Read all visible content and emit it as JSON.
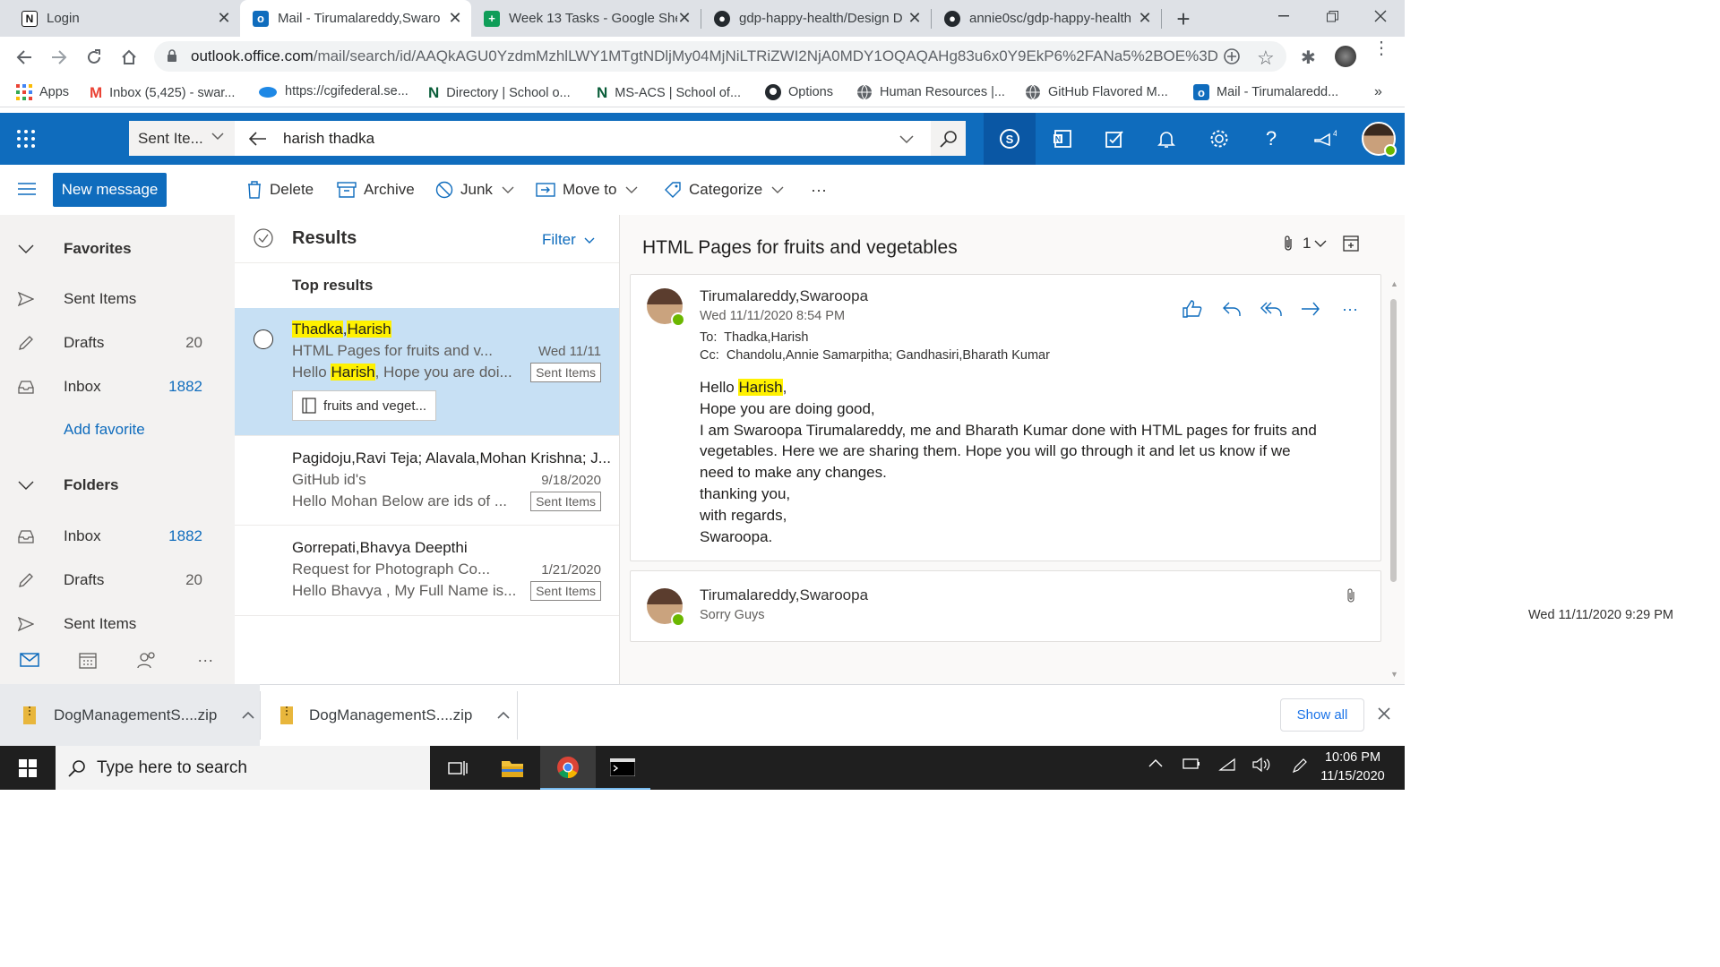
{
  "browser": {
    "tabs": [
      {
        "title": "Login",
        "icon": "notion-icon",
        "active": false
      },
      {
        "title": "Mail - Tirumalareddy,Swaro",
        "icon": "outlook-icon",
        "active": true
      },
      {
        "title": "Week 13 Tasks - Google She",
        "icon": "sheets-icon",
        "active": false
      },
      {
        "title": "gdp-happy-health/Design D",
        "icon": "github-icon",
        "active": false
      },
      {
        "title": "annie0sc/gdp-happy-health",
        "icon": "github-icon",
        "active": false
      }
    ],
    "url_host": "outlook.office.com",
    "url_path": "/mail/search/id/AAQkAGU0YzdmMzhlLWY1MTgtNDljMy04MjNiLTRiZWI2NjA0MDY1OQAQAHg83u6x0Y9EkP6%2FANa5%2BOE%3D",
    "bookmarks": [
      {
        "label": "Apps",
        "icon": "apps-grid-icon"
      },
      {
        "label": "Inbox (5,425) - swar...",
        "icon": "gmail-icon"
      },
      {
        "label": "https://cgifederal.se...",
        "icon": "cloud-icon"
      },
      {
        "label": "Directory | School o...",
        "icon": "notion-icon"
      },
      {
        "label": "MS-ACS | School of...",
        "icon": "notion-icon"
      },
      {
        "label": "Options",
        "icon": "github-icon"
      },
      {
        "label": "Human Resources |...",
        "icon": "globe-icon"
      },
      {
        "label": "GitHub Flavored M...",
        "icon": "globe-icon"
      },
      {
        "label": "Mail - Tirumalaredd...",
        "icon": "outlook-icon"
      }
    ]
  },
  "owa": {
    "scope": "Sent Ite...",
    "search_query": "harish thadka",
    "toolbar": {
      "new_message": "New message",
      "delete": "Delete",
      "archive": "Archive",
      "junk": "Junk",
      "move_to": "Move to",
      "categorize": "Categorize",
      "more": "···"
    },
    "nav": {
      "favorites_label": "Favorites",
      "favorites": [
        {
          "label": "Sent Items",
          "count": "",
          "icon": "send-icon"
        },
        {
          "label": "Drafts",
          "count": "20",
          "icon": "pencil-icon"
        },
        {
          "label": "Inbox",
          "count": "1882",
          "icon": "inbox-icon"
        }
      ],
      "add_favorite": "Add favorite",
      "folders_label": "Folders",
      "folders": [
        {
          "label": "Inbox",
          "count": "1882",
          "icon": "inbox-icon"
        },
        {
          "label": "Drafts",
          "count": "20",
          "icon": "pencil-icon"
        },
        {
          "label": "Sent Items",
          "count": "",
          "icon": "send-icon"
        }
      ]
    },
    "list": {
      "title": "Results",
      "filter": "Filter",
      "section": "Top results",
      "items": [
        {
          "from_a": "Thadka",
          "from_sep": ",",
          "from_b": "Harish",
          "subject": "HTML Pages for fruits and v...",
          "date": "Wed 11/11",
          "preview_a": "Hello ",
          "preview_hl": "Harish",
          "preview_b": ", Hope you are doi...",
          "tag": "Sent Items",
          "attachment": "fruits and veget..."
        },
        {
          "from": "Pagidoju,Ravi Teja; Alavala,Mohan Krishna; J...",
          "subject": "GitHub id's",
          "date": "9/18/2020",
          "preview": "Hello Mohan Below are ids of ...",
          "tag": "Sent Items"
        },
        {
          "from": "Gorrepati,Bhavya Deepthi",
          "subject": "Request for Photograph Co...",
          "date": "1/21/2020",
          "preview": "Hello Bhavya , My Full Name is...",
          "tag": "Sent Items"
        }
      ]
    },
    "reading": {
      "subject": "HTML Pages for fruits and vegetables",
      "attach_count": "1",
      "message1": {
        "sender": "Tirumalareddy,Swaroopa",
        "datetime": "Wed 11/11/2020 8:54 PM",
        "to_label": "To:",
        "to": "Thadka,Harish",
        "cc_label": "Cc:",
        "cc": "Chandolu,Annie Samarpitha; Gandhasiri,Bharath Kumar",
        "greeting_a": "Hello ",
        "greeting_hl": "Harish",
        "greeting_b": ",",
        "lines": [
          "Hope you are doing good,",
          "I am Swaroopa Tirumalareddy, me and Bharath Kumar done with HTML pages for fruits and",
          "vegetables. Here we are sharing them. Hope you will go through it and let us know if we",
          "need to make any changes.",
          "thanking you,",
          "with regards,",
          "Swaroopa."
        ]
      },
      "message2": {
        "sender": "Tirumalareddy,Swaroopa",
        "preview": "Sorry Guys",
        "datetime": "Wed 11/11/2020 9:29 PM"
      }
    }
  },
  "downloads": {
    "items": [
      "DogManagementS....zip",
      "DogManagementS....zip"
    ],
    "show_all": "Show all"
  },
  "taskbar": {
    "search_placeholder": "Type here to search",
    "time": "10:06 PM",
    "date": "11/15/2020"
  },
  "colors": {
    "owa_blue": "#0f6cbd",
    "selected_row": "#c7e0f4",
    "highlight": "#fff100",
    "presence_green": "#6bb700"
  }
}
